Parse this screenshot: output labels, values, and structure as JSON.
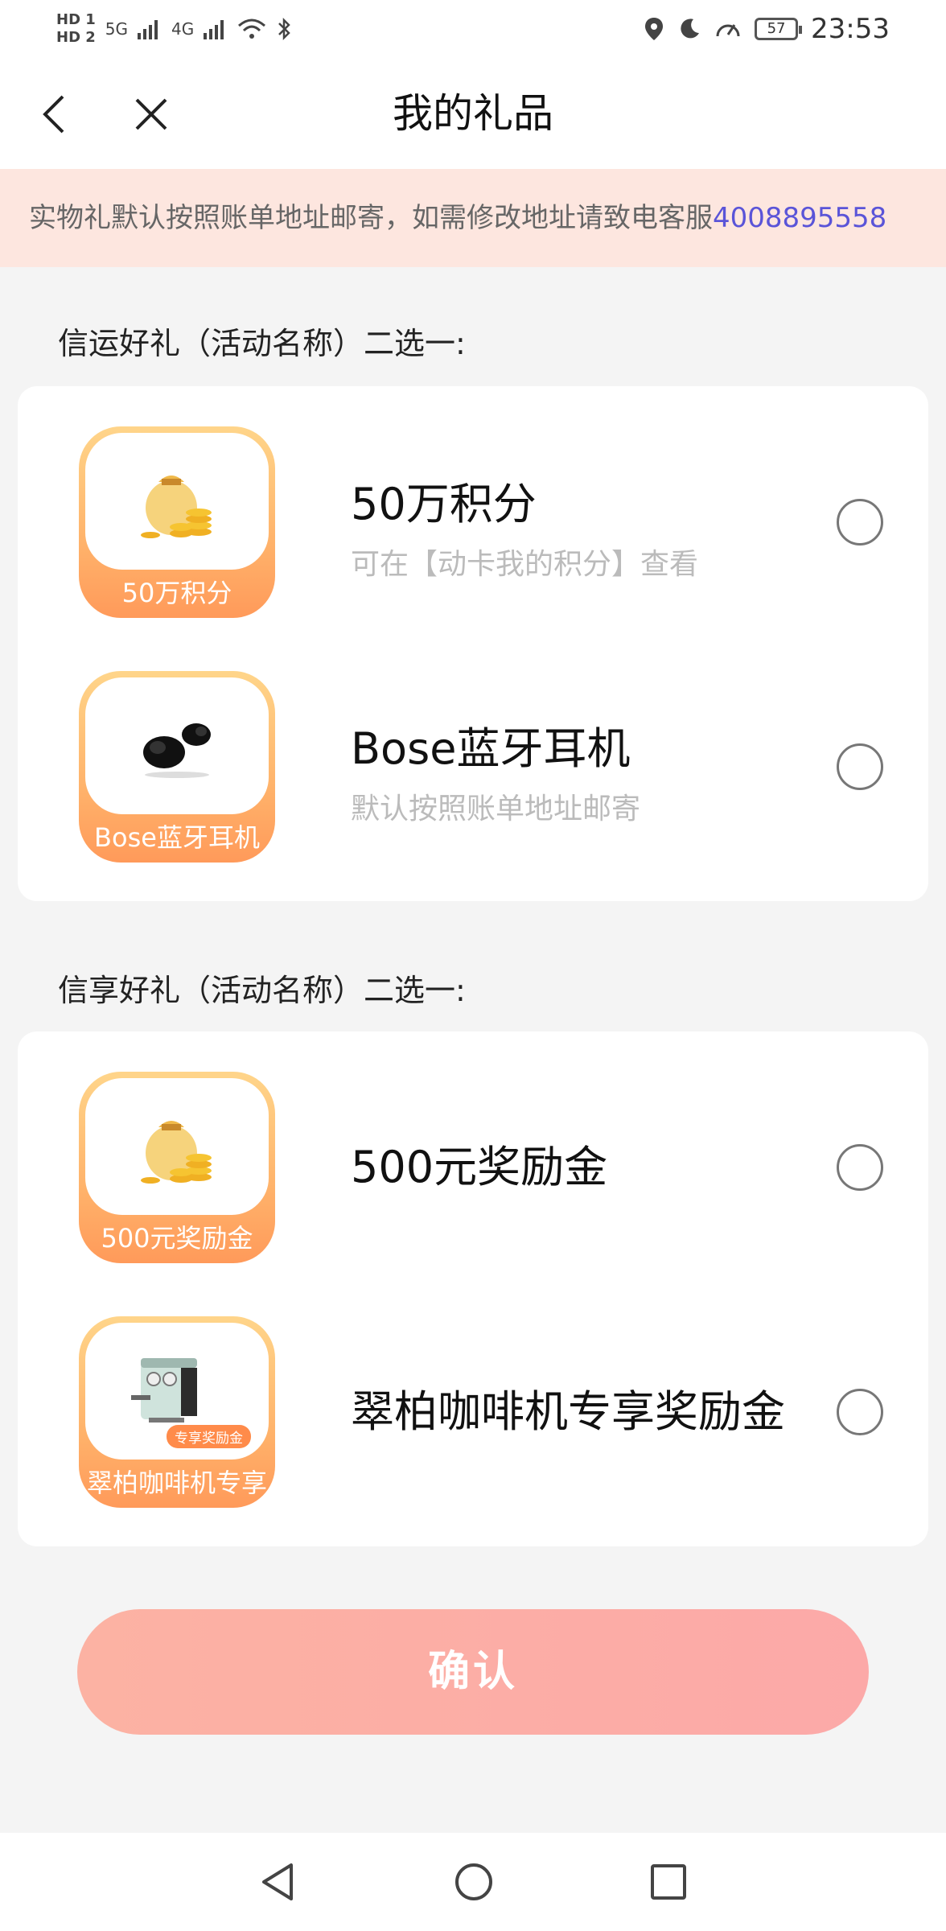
{
  "status_bar": {
    "hd1": "HD 1",
    "hd2": "HD 2",
    "net1": "5G",
    "net2": "4G",
    "battery": "57",
    "time": "23:53"
  },
  "header": {
    "title": "我的礼品"
  },
  "notice": {
    "text": "实物礼默认按照账单地址邮寄，如需修改地址请致电客服",
    "phone": "4008895558"
  },
  "sections": [
    {
      "title": "信运好礼（活动名称）二选一:",
      "items": [
        {
          "thumb_label": "50万积分",
          "title": "50万积分",
          "subtitle": "可在【动卡我的积分】查看"
        },
        {
          "thumb_label": "Bose蓝牙耳机",
          "title": "Bose蓝牙耳机",
          "subtitle": "默认按照账单地址邮寄"
        }
      ]
    },
    {
      "title": "信享好礼（活动名称）二选一:",
      "items": [
        {
          "thumb_label": "500元奖励金",
          "title": "500元奖励金",
          "subtitle": ""
        },
        {
          "thumb_label": "翠柏咖啡机专享",
          "title": "翠柏咖啡机专享奖励金",
          "subtitle": "",
          "tag": "专享奖励金"
        }
      ]
    }
  ],
  "confirm_button": {
    "label": "确认"
  },
  "colors": {
    "notice_bg": "#fde6df",
    "phone_link": "#5a54d8",
    "button_gradient_start": "#fcb2a3",
    "button_gradient_end": "#fca9a8",
    "thumb_orange": "#ffb36b"
  }
}
